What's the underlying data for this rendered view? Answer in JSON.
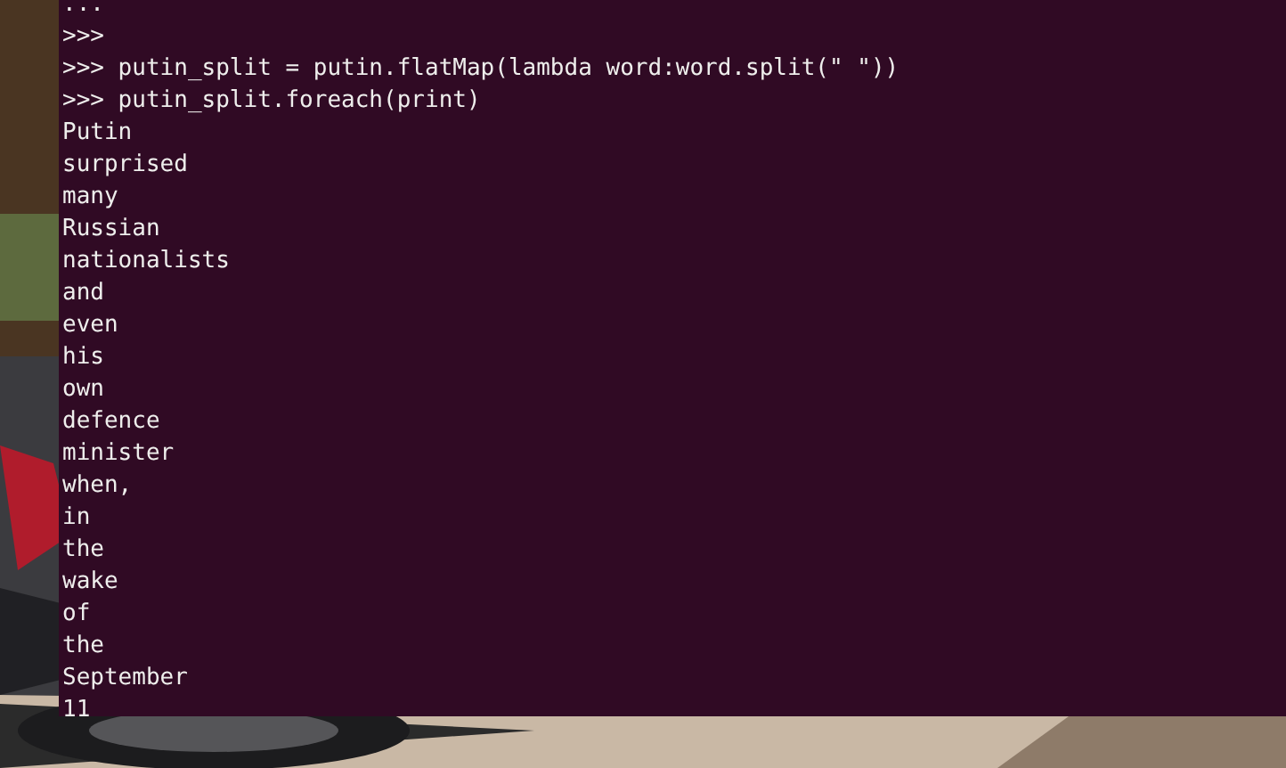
{
  "terminal": {
    "lines": [
      "...",
      ">>>",
      ">>> putin_split = putin.flatMap(lambda word:word.split(\" \"))",
      ">>> putin_split.foreach(print)",
      "Putin",
      "surprised",
      "many",
      "Russian",
      "nationalists",
      "and",
      "even",
      "his",
      "own",
      "defence",
      "minister",
      "when,",
      "in",
      "the",
      "wake",
      "of",
      "the",
      "September",
      "11"
    ]
  }
}
